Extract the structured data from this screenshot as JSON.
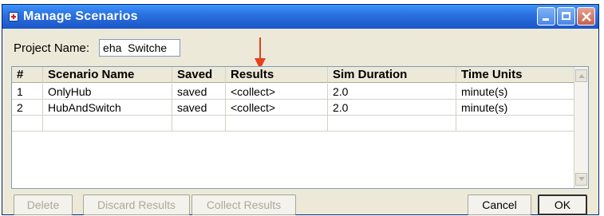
{
  "window": {
    "title": "Manage Scenarios"
  },
  "project": {
    "label": "Project Name:",
    "value": "eha  Switche"
  },
  "table": {
    "columns": [
      "#",
      "Scenario Name",
      "Saved",
      "Results",
      "Sim Duration",
      "Time Units"
    ],
    "rows": [
      [
        "1",
        "OnlyHub",
        "saved",
        "<collect>",
        "2.0",
        "minute(s)"
      ],
      [
        "2",
        "HubAndSwitch",
        "saved",
        "<collect>",
        "2.0",
        "minute(s)"
      ]
    ]
  },
  "buttons": {
    "delete": "Delete",
    "discard": "Discard Results",
    "collect": "Collect Results",
    "cancel": "Cancel",
    "ok": "OK"
  },
  "colors": {
    "titlebar": "#2b71e0",
    "annotation_arrow": "#e8401c"
  }
}
